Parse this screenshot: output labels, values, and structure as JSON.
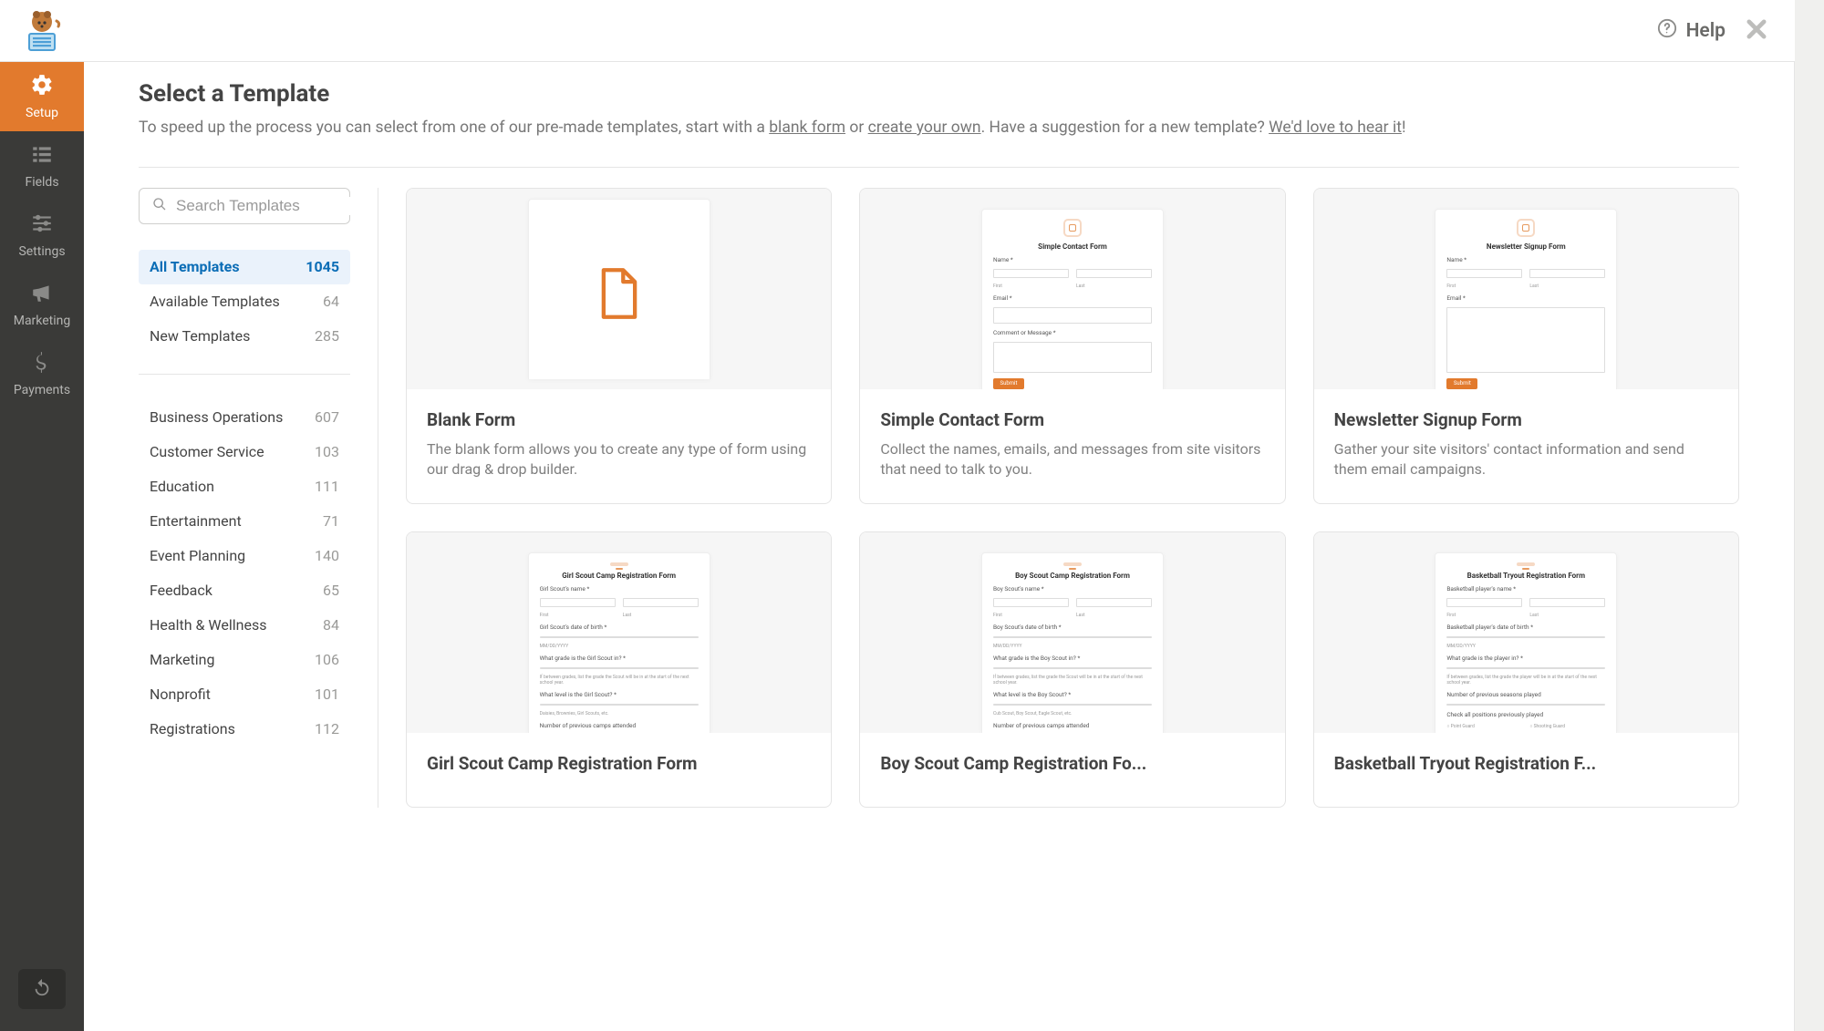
{
  "sidebar": {
    "items": [
      {
        "label": "Setup"
      },
      {
        "label": "Fields"
      },
      {
        "label": "Settings"
      },
      {
        "label": "Marketing"
      },
      {
        "label": "Payments"
      }
    ]
  },
  "topbar": {
    "help_label": "Help"
  },
  "header": {
    "title": "Select a Template",
    "sub_pre": "To speed up the process you can select from one of our pre-made templates, start with a ",
    "link_blank": "blank form",
    "sub_or": " or ",
    "link_create": "create your own",
    "sub_post": ". Have a suggestion for a new template? ",
    "link_feedback": "We'd love to hear it",
    "sub_end": "!"
  },
  "search": {
    "placeholder": "Search Templates"
  },
  "filter_groups": {
    "top": [
      {
        "label": "All Templates",
        "count": "1045",
        "active": true
      },
      {
        "label": "Available Templates",
        "count": "64"
      },
      {
        "label": "New Templates",
        "count": "285"
      }
    ],
    "categories": [
      {
        "label": "Business Operations",
        "count": "607"
      },
      {
        "label": "Customer Service",
        "count": "103"
      },
      {
        "label": "Education",
        "count": "111"
      },
      {
        "label": "Entertainment",
        "count": "71"
      },
      {
        "label": "Event Planning",
        "count": "140"
      },
      {
        "label": "Feedback",
        "count": "65"
      },
      {
        "label": "Health & Wellness",
        "count": "84"
      },
      {
        "label": "Marketing",
        "count": "106"
      },
      {
        "label": "Nonprofit",
        "count": "101"
      },
      {
        "label": "Registrations",
        "count": "112"
      }
    ]
  },
  "templates": [
    {
      "title": "Blank Form",
      "desc": "The blank form allows you to create any type of form using our drag & drop builder.",
      "preview": {
        "kind": "blank"
      }
    },
    {
      "title": "Simple Contact Form",
      "desc": "Collect the names, emails, and messages from site visitors that need to talk to you.",
      "preview": {
        "kind": "form",
        "heading": "Simple Contact Form",
        "rows": [
          {
            "type": "name",
            "label": "Name *",
            "sub": [
              "First",
              "Last"
            ]
          },
          {
            "type": "single",
            "label": "Email *"
          },
          {
            "type": "textarea",
            "label": "Comment or Message *"
          },
          {
            "type": "submit"
          }
        ]
      }
    },
    {
      "title": "Newsletter Signup Form",
      "desc": "Gather your site visitors' contact information and send them email campaigns.",
      "preview": {
        "kind": "form",
        "heading": "Newsletter Signup Form",
        "rows": [
          {
            "type": "name",
            "label": "Name *",
            "sub": [
              "First",
              "Last"
            ]
          },
          {
            "type": "single",
            "label": "Email *"
          },
          {
            "type": "submit"
          }
        ]
      }
    },
    {
      "title": "Girl Scout Camp Registration Form",
      "desc": "",
      "preview": {
        "kind": "form",
        "heading": "Girl Scout Camp Registration Form",
        "rows": [
          {
            "type": "name",
            "label": "Girl Scout's name *",
            "sub": [
              "First",
              "Last"
            ]
          },
          {
            "type": "single",
            "label": "Girl Scout's date of birth *",
            "placeholder": "MM/DD/YYYY"
          },
          {
            "type": "single",
            "label": "What grade is the Girl Scout in? *",
            "help": "If between grades, list the grade the Scout will be in at the start of the next school year."
          },
          {
            "type": "single",
            "label": "What level is the Girl Scout? *",
            "help": "Daisies, Brownies, Girl Scouts, etc."
          },
          {
            "type": "single_nohint",
            "label": "Number of previous camps attended"
          }
        ]
      }
    },
    {
      "title": "Boy Scout Camp Registration Fo...",
      "desc": "",
      "preview": {
        "kind": "form",
        "heading": "Boy Scout Camp Registration Form",
        "rows": [
          {
            "type": "name",
            "label": "Boy Scout's name *",
            "sub": [
              "First",
              "Last"
            ]
          },
          {
            "type": "single",
            "label": "Boy Scout's date of birth *",
            "placeholder": "MM/DD/YYYY"
          },
          {
            "type": "single",
            "label": "What grade is the Boy Scout in? *",
            "help": "If between grades, list the grade the Scout will be in at the start of the next school year."
          },
          {
            "type": "single",
            "label": "What level is the Boy Scout? *",
            "help": "Cub Scout, Boy Scout, Eagle Scout, etc."
          },
          {
            "type": "single_nohint",
            "label": "Number of previous camps attended"
          }
        ]
      }
    },
    {
      "title": "Basketball Tryout Registration F...",
      "desc": "",
      "preview": {
        "kind": "form",
        "heading": "Basketball Tryout Registration Form",
        "rows": [
          {
            "type": "name",
            "label": "Basketball player's name *",
            "sub": [
              "First",
              "Last"
            ]
          },
          {
            "type": "single",
            "label": "Basketball player's date of birth *",
            "placeholder": "MM/DD/YYYY"
          },
          {
            "type": "single",
            "label": "What grade is the player in? *",
            "help": "If between grades, list the grade the player will be in at the start of the next school year."
          },
          {
            "type": "single_nohint",
            "label": "Number of previous seasons played"
          },
          {
            "type": "checks",
            "label": "Check all positions previously played",
            "options": [
              [
                "Point Guard",
                "Shooting Guard"
              ],
              [
                "",
                ""
              ]
            ]
          }
        ]
      }
    }
  ]
}
